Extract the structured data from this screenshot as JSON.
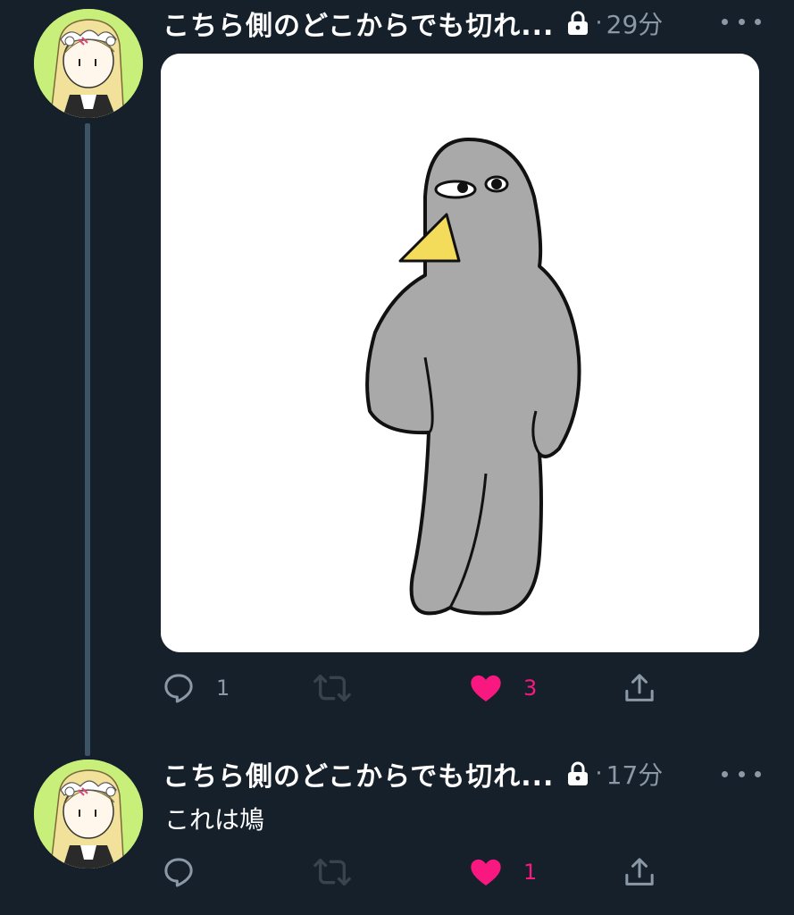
{
  "tweets": [
    {
      "display_name": "こちら側のどこからでも切れ...",
      "time": "29分",
      "separator": "·",
      "reply_count": "1",
      "retweet_count": "",
      "like_count": "3",
      "liked": true,
      "has_media": true,
      "media_subject": "gray bird illustration"
    },
    {
      "display_name": "こちら側のどこからでも切れ...",
      "time": "17分",
      "separator": "·",
      "text": "これは鳩",
      "reply_count": "",
      "retweet_count": "",
      "like_count": "1",
      "liked": true,
      "has_media": false
    }
  ],
  "colors": {
    "background": "#15202b",
    "text_primary": "#ffffff",
    "text_secondary": "#8b98a5",
    "like": "#f91880",
    "thread_line": "#3d5466"
  },
  "icons": [
    "lock-icon",
    "more-icon",
    "reply-icon",
    "retweet-icon",
    "like-icon",
    "share-icon"
  ]
}
